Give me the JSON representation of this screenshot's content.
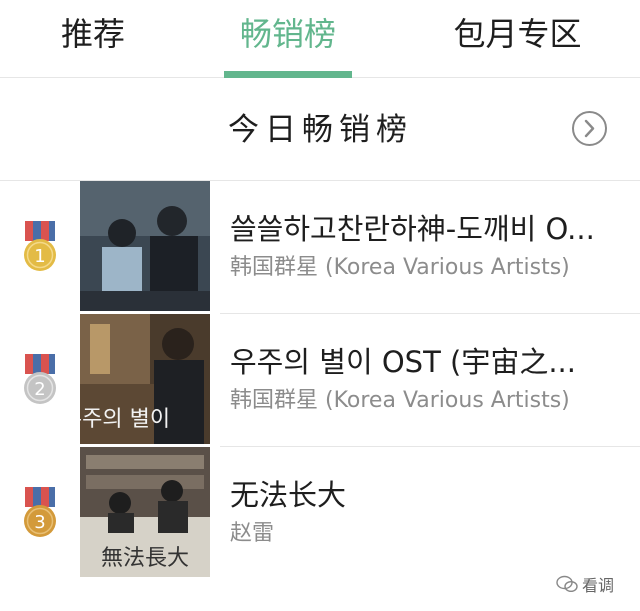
{
  "tabs": [
    {
      "label": "推荐",
      "active": false
    },
    {
      "label": "畅销榜",
      "active": true
    },
    {
      "label": "包月专区",
      "active": false
    }
  ],
  "section": {
    "title": "今日畅销榜",
    "more_icon": "chevron-right-circle-icon"
  },
  "items": [
    {
      "rank": "1",
      "title": "쓸쓸하고찬란하神-도깨비 O...",
      "artist": "韩国群星 (Korea Various Artists)",
      "medal_color": "#e3bb45"
    },
    {
      "rank": "2",
      "title": "우주의 별이 OST (宇宙之...",
      "artist": "韩国群星 (Korea Various Artists)",
      "medal_color": "#c4c4c4"
    },
    {
      "rank": "3",
      "title": "无法长大",
      "artist": "赵雷",
      "medal_color": "#d39a3a"
    }
  ],
  "colors": {
    "accent": "#62b68d",
    "ribbon_red": "#d9534f",
    "ribbon_blue": "#4a6ea8"
  },
  "watermark": {
    "label": "看调",
    "icon": "wechat-icon"
  }
}
